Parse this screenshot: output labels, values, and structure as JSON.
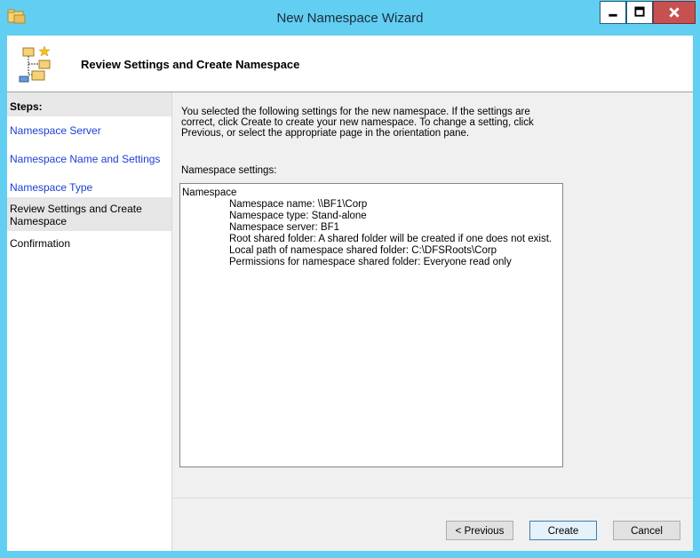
{
  "window": {
    "title": "New Namespace Wizard",
    "icon": "folder-namespace-icon",
    "controls": [
      "minimize-icon",
      "maximize-icon",
      "close-icon"
    ],
    "frame_color": "#62cef1"
  },
  "header": {
    "title": "Review Settings and Create Namespace",
    "icon": "namespace-tree-icon"
  },
  "steps": {
    "title": "Steps:",
    "items": [
      {
        "label": "Namespace Server",
        "state": "link"
      },
      {
        "label": "Namespace Name and Settings",
        "state": "link"
      },
      {
        "label": "Namespace Type",
        "state": "link"
      },
      {
        "label": "Review Settings and Create Namespace",
        "state": "current"
      },
      {
        "label": "Confirmation",
        "state": "pending"
      }
    ]
  },
  "main": {
    "description": "You selected the following settings for the new namespace. If the settings are correct, click Create to create your new namespace. To change a setting, click Previous, or select the appropriate page in the orientation pane.",
    "settings_label": "Namespace settings:",
    "settings": {
      "heading": "Namespace",
      "lines": [
        "Namespace name: \\\\BF1\\Corp",
        "Namespace type:  Stand-alone",
        "Namespace server: BF1",
        "Root shared folder:  A shared folder will be created if one does not exist.",
        "Local path of namespace shared folder: C:\\DFSRoots\\Corp",
        "Permissions for namespace shared folder: Everyone read only"
      ]
    }
  },
  "buttons": {
    "previous": "< Previous",
    "create": "Create",
    "cancel": "Cancel"
  },
  "colors": {
    "link": "#1a3fd6",
    "close_button": "#c75050"
  }
}
